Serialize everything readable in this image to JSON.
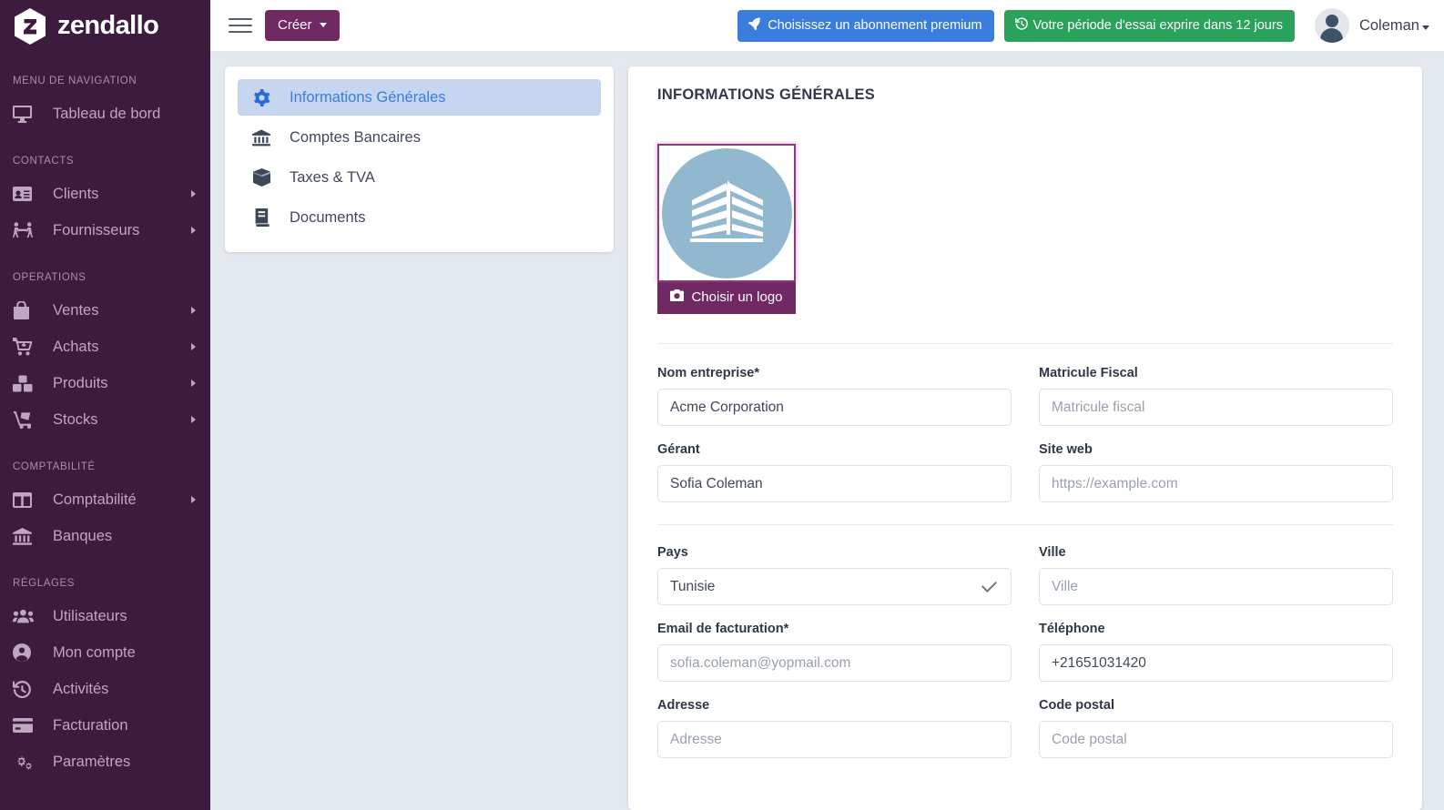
{
  "brand": {
    "name": "zendallo",
    "logo_icon": "hexagon-z-logo"
  },
  "sidebar": {
    "sections": [
      {
        "title": "MENU DE NAVIGATION",
        "items": [
          {
            "label": "Tableau de bord",
            "icon": "desktop-icon",
            "has_submenu": false
          }
        ]
      },
      {
        "title": "CONTACTS",
        "items": [
          {
            "label": "Clients",
            "icon": "id-card-icon",
            "has_submenu": true
          },
          {
            "label": "Fournisseurs",
            "icon": "people-carry-icon",
            "has_submenu": true
          }
        ]
      },
      {
        "title": "OPERATIONS",
        "items": [
          {
            "label": "Ventes",
            "icon": "shopping-bag-icon",
            "has_submenu": true
          },
          {
            "label": "Achats",
            "icon": "shopping-cart-icon",
            "has_submenu": true
          },
          {
            "label": "Produits",
            "icon": "boxes-icon",
            "has_submenu": true
          },
          {
            "label": "Stocks",
            "icon": "dolly-icon",
            "has_submenu": true
          }
        ]
      },
      {
        "title": "COMPTABILITÉ",
        "items": [
          {
            "label": "Comptabilité",
            "icon": "columns-icon",
            "has_submenu": true
          },
          {
            "label": "Banques",
            "icon": "bank-icon",
            "has_submenu": false
          }
        ]
      },
      {
        "title": "RÉGLAGES",
        "items": [
          {
            "label": "Utilisateurs",
            "icon": "users-icon",
            "has_submenu": false
          },
          {
            "label": "Mon compte",
            "icon": "user-circle-icon",
            "has_submenu": false
          },
          {
            "label": "Activités",
            "icon": "history-icon",
            "has_submenu": false
          },
          {
            "label": "Facturation",
            "icon": "credit-card-icon",
            "has_submenu": false
          },
          {
            "label": "Paramètres",
            "icon": "cogs-icon",
            "has_submenu": false
          }
        ]
      }
    ]
  },
  "topbar": {
    "menu_toggle_icon": "hamburger-icon",
    "create_label": "Créer",
    "premium_label": "Choisissez un abonnement premium",
    "premium_icon": "rocket-icon",
    "premium_color": "#3b7ddd",
    "trial_label": "Votre période d'essai exprire dans 12 jours",
    "trial_icon": "history-icon",
    "trial_color": "#2aa259",
    "user_name": "Coleman",
    "avatar_icon": "user-avatar"
  },
  "tabs": [
    {
      "label": "Informations Générales",
      "icon": "gear-icon",
      "active": true
    },
    {
      "label": "Comptes Bancaires",
      "icon": "bank-icon",
      "active": false
    },
    {
      "label": "Taxes & TVA",
      "icon": "box-icon",
      "active": false
    },
    {
      "label": "Documents",
      "icon": "book-icon",
      "active": false
    }
  ],
  "form": {
    "title": "INFORMATIONS GÉNÉRALES",
    "logo": {
      "image_icon": "building-logo",
      "border_color": "#8e3a7e",
      "circle_color": "#92b8cf",
      "button_label": "Choisir un logo",
      "button_icon": "camera-icon",
      "button_color": "#702963"
    },
    "fields": [
      {
        "label": "Nom entreprise*",
        "name": "company-name",
        "value": "Acme Corporation",
        "placeholder": "",
        "type": "text"
      },
      {
        "label": "Matricule Fiscal",
        "name": "tax-id",
        "value": "",
        "placeholder": "Matricule fiscal",
        "type": "text"
      },
      {
        "label": "Gérant",
        "name": "manager",
        "value": "Sofia Coleman",
        "placeholder": "",
        "type": "text"
      },
      {
        "label": "Site web",
        "name": "website",
        "value": "",
        "placeholder": "https://example.com",
        "type": "text"
      },
      {
        "label": "Pays",
        "name": "country",
        "value": "Tunisie",
        "placeholder": "",
        "type": "select"
      },
      {
        "label": "Ville",
        "name": "city",
        "value": "",
        "placeholder": "Ville",
        "type": "text"
      },
      {
        "label": "Email de facturation*",
        "name": "billing-email",
        "value": "",
        "placeholder": "sofia.coleman@yopmail.com",
        "type": "text"
      },
      {
        "label": "Téléphone",
        "name": "phone",
        "value": "+21651031420",
        "placeholder": "",
        "type": "text"
      },
      {
        "label": "Adresse",
        "name": "address",
        "value": "",
        "placeholder": "Adresse",
        "type": "text"
      },
      {
        "label": "Code postal",
        "name": "postal-code",
        "value": "",
        "placeholder": "Code postal",
        "type": "text"
      }
    ]
  }
}
